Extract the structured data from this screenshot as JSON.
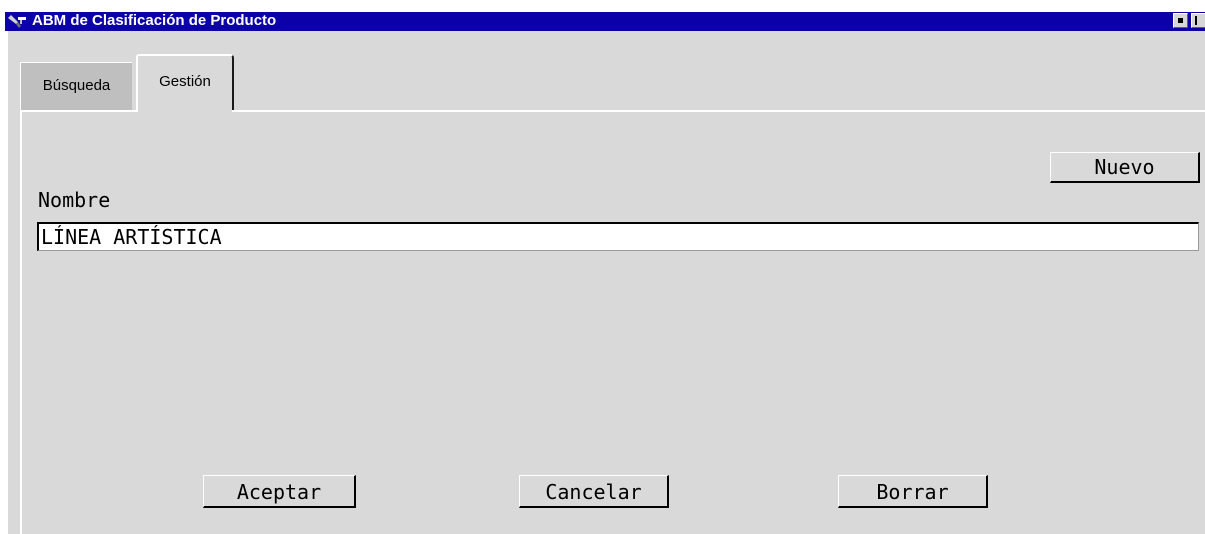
{
  "window": {
    "title": "ABM de Clasificación de Producto",
    "title_bar_color": "#0c00a8",
    "app_icon": "tools-icon",
    "controls": [
      "maximize-icon",
      "close-icon"
    ]
  },
  "tabs": [
    {
      "label": "Búsqueda",
      "active": false
    },
    {
      "label": "Gestión",
      "active": true
    }
  ],
  "form": {
    "nuevo_label": "Nuevo",
    "nombre_label": "Nombre",
    "nombre_value": "LÍNEA ARTÍSTICA"
  },
  "actions": {
    "aceptar_label": "Aceptar",
    "cancelar_label": "Cancelar",
    "borrar_label": "Borrar"
  },
  "colors": {
    "panel_background": "#d9d9d9",
    "inactive_tab": "#bfbfbf",
    "input_background": "#ffffff"
  }
}
